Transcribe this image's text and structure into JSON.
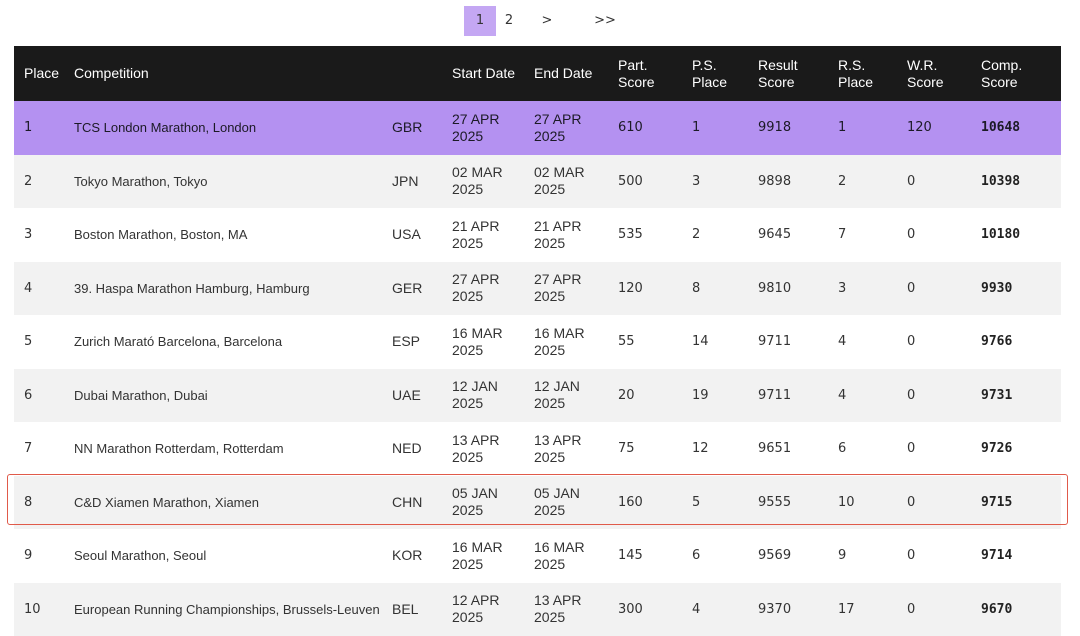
{
  "pagination": {
    "pages": [
      "1",
      "2"
    ],
    "current": "1",
    "next_label": ">",
    "last_label": ">>"
  },
  "table": {
    "headers": {
      "place": "Place",
      "competition": "Competition",
      "start_date": "Start Date",
      "end_date": "End Date",
      "part_score": [
        "Part.",
        "Score"
      ],
      "ps_place": [
        "P.S.",
        "Place"
      ],
      "result_score": [
        "Result",
        "Score"
      ],
      "rs_place": [
        "R.S.",
        "Place"
      ],
      "wr_score": [
        "W.R.",
        "Score"
      ],
      "comp_score": [
        "Comp.",
        "Score"
      ]
    },
    "rows": [
      {
        "place": "1",
        "competition": "TCS London Marathon, London",
        "country": "GBR",
        "start": [
          "27 APR",
          "2025"
        ],
        "end": [
          "27 APR",
          "2025"
        ],
        "part": "610",
        "ps_place": "1",
        "result": "9918",
        "rs_place": "1",
        "wr": "120",
        "comp": "10648"
      },
      {
        "place": "2",
        "competition": "Tokyo Marathon, Tokyo",
        "country": "JPN",
        "start": [
          "02 MAR",
          "2025"
        ],
        "end": [
          "02 MAR",
          "2025"
        ],
        "part": "500",
        "ps_place": "3",
        "result": "9898",
        "rs_place": "2",
        "wr": "0",
        "comp": "10398"
      },
      {
        "place": "3",
        "competition": "Boston Marathon, Boston, MA",
        "country": "USA",
        "start": [
          "21 APR",
          "2025"
        ],
        "end": [
          "21 APR",
          "2025"
        ],
        "part": "535",
        "ps_place": "2",
        "result": "9645",
        "rs_place": "7",
        "wr": "0",
        "comp": "10180"
      },
      {
        "place": "4",
        "competition": "39. Haspa Marathon Hamburg, Hamburg",
        "country": "GER",
        "start": [
          "27 APR",
          "2025"
        ],
        "end": [
          "27 APR",
          "2025"
        ],
        "part": "120",
        "ps_place": "8",
        "result": "9810",
        "rs_place": "3",
        "wr": "0",
        "comp": "9930"
      },
      {
        "place": "5",
        "competition": "Zurich Marató Barcelona, Barcelona",
        "country": "ESP",
        "start": [
          "16 MAR",
          "2025"
        ],
        "end": [
          "16 MAR",
          "2025"
        ],
        "part": "55",
        "ps_place": "14",
        "result": "9711",
        "rs_place": "4",
        "wr": "0",
        "comp": "9766"
      },
      {
        "place": "6",
        "competition": "Dubai Marathon, Dubai",
        "country": "UAE",
        "start": [
          "12 JAN",
          "2025"
        ],
        "end": [
          "12 JAN",
          "2025"
        ],
        "part": "20",
        "ps_place": "19",
        "result": "9711",
        "rs_place": "4",
        "wr": "0",
        "comp": "9731"
      },
      {
        "place": "7",
        "competition": "NN Marathon Rotterdam, Rotterdam",
        "country": "NED",
        "start": [
          "13 APR",
          "2025"
        ],
        "end": [
          "13 APR",
          "2025"
        ],
        "part": "75",
        "ps_place": "12",
        "result": "9651",
        "rs_place": "6",
        "wr": "0",
        "comp": "9726"
      },
      {
        "place": "8",
        "competition": "C&D Xiamen Marathon, Xiamen",
        "country": "CHN",
        "start": [
          "05 JAN",
          "2025"
        ],
        "end": [
          "05 JAN",
          "2025"
        ],
        "part": "160",
        "ps_place": "5",
        "result": "9555",
        "rs_place": "10",
        "wr": "0",
        "comp": "9715"
      },
      {
        "place": "9",
        "competition": "Seoul Marathon, Seoul",
        "country": "KOR",
        "start": [
          "16 MAR",
          "2025"
        ],
        "end": [
          "16 MAR",
          "2025"
        ],
        "part": "145",
        "ps_place": "6",
        "result": "9569",
        "rs_place": "9",
        "wr": "0",
        "comp": "9714"
      },
      {
        "place": "10",
        "competition": "European Running Championships, Brussels-Leuven",
        "country": "BEL",
        "start": [
          "12 APR",
          "2025"
        ],
        "end": [
          "13 APR",
          "2025"
        ],
        "part": "300",
        "ps_place": "4",
        "result": "9370",
        "rs_place": "17",
        "wr": "0",
        "comp": "9670"
      }
    ]
  },
  "colors": {
    "header_bg": "#1a1a1a",
    "highlight_row": "#b491f1",
    "active_page": "#c4a7f3",
    "outline": "#e05a4a",
    "stripe": "#f2f2f2"
  }
}
